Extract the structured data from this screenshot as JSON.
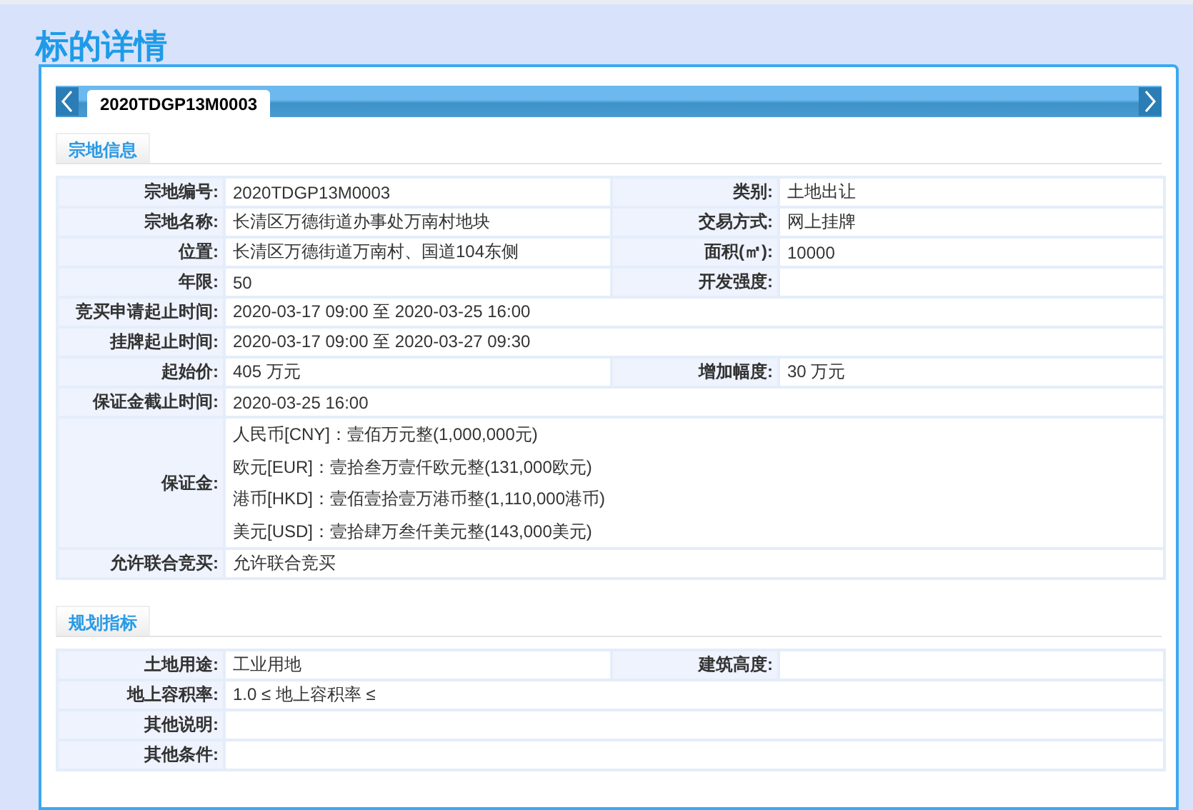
{
  "page_title": "标的详情",
  "tabs": [
    {
      "label": "2020TDGP13M0003",
      "selected": true
    }
  ],
  "sections": [
    {
      "title": "宗地信息",
      "rows": [
        {
          "cells": [
            {
              "label": "宗地编号:",
              "value": "2020TDGP13M0003"
            },
            {
              "label": "类别:",
              "value": "土地出让"
            }
          ]
        },
        {
          "cells": [
            {
              "label": "宗地名称:",
              "value": "长清区万德街道办事处万南村地块"
            },
            {
              "label": "交易方式:",
              "value": "网上挂牌"
            }
          ]
        },
        {
          "cells": [
            {
              "label": "位置:",
              "value": "长清区万德街道万南村、国道104东侧"
            },
            {
              "label": "面积(㎡):",
              "value": "10000"
            }
          ]
        },
        {
          "cells": [
            {
              "label": "年限:",
              "value": "50"
            },
            {
              "label": "开发强度:"
            }
          ]
        },
        {
          "cells": [
            {
              "label": "竞买申请起止时间:",
              "value": "2020-03-17 09:00 至 2020-03-25 16:00"
            }
          ]
        },
        {
          "cells": [
            {
              "label": "挂牌起止时间:",
              "value": "2020-03-17 09:00 至 2020-03-27 09:30"
            }
          ]
        },
        {
          "cells": [
            {
              "label": "起始价:",
              "value": "405 万元"
            },
            {
              "label": "增加幅度:",
              "value": "30 万元"
            }
          ]
        },
        {
          "cells": [
            {
              "label": "保证金截止时间:",
              "value": "2020-03-25 16:00"
            }
          ]
        },
        {
          "cells": [
            {
              "label": "保证金:",
              "lines": [
                "人民币[CNY]：壹佰万元整(1,000,000元)",
                "欧元[EUR]：壹拾叁万壹仟欧元整(131,000欧元)",
                "港币[HKD]：壹佰壹拾壹万港币整(1,110,000港币)",
                "美元[USD]：壹拾肆万叁仟美元整(143,000美元)"
              ]
            }
          ]
        },
        {
          "cells": [
            {
              "label": "允许联合竞买:",
              "value": "允许联合竞买"
            }
          ]
        }
      ]
    },
    {
      "title": "规划指标",
      "rows": [
        {
          "cells": [
            {
              "label": "土地用途:",
              "value": "工业用地"
            },
            {
              "label": "建筑高度:"
            }
          ]
        },
        {
          "cells": [
            {
              "label": "地上容积率:",
              "value": "1.0 ≤ 地上容积率 ≤"
            }
          ]
        },
        {
          "cells": [
            {
              "label": "其他说明:"
            }
          ]
        },
        {
          "cells": [
            {
              "label": "其他条件:"
            }
          ]
        }
      ]
    }
  ]
}
